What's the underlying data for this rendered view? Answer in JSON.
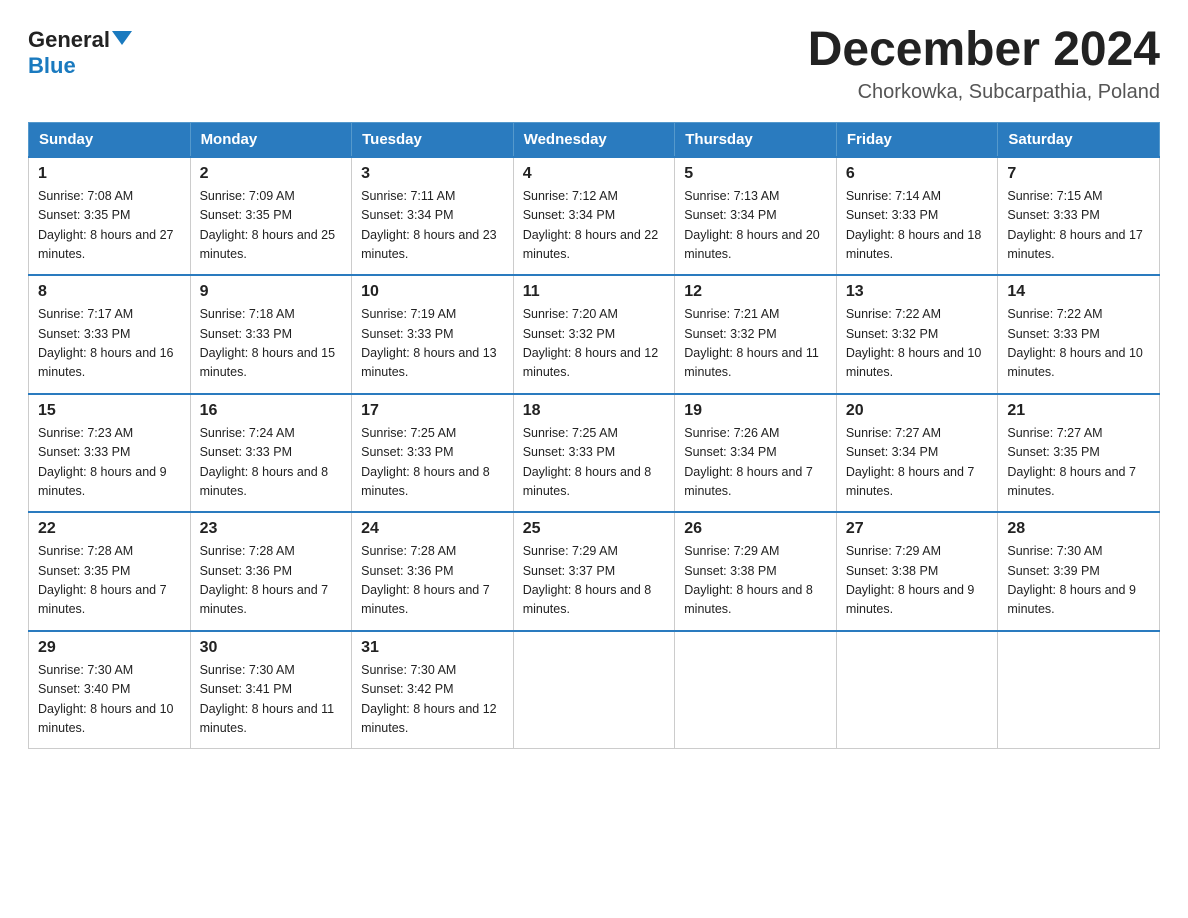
{
  "logo": {
    "line1": "General",
    "arrow": true,
    "line2": "Blue"
  },
  "title": "December 2024",
  "subtitle": "Chorkowka, Subcarpathia, Poland",
  "days_of_week": [
    "Sunday",
    "Monday",
    "Tuesday",
    "Wednesday",
    "Thursday",
    "Friday",
    "Saturday"
  ],
  "weeks": [
    [
      {
        "num": "1",
        "sunrise": "7:08 AM",
        "sunset": "3:35 PM",
        "daylight": "8 hours and 27 minutes."
      },
      {
        "num": "2",
        "sunrise": "7:09 AM",
        "sunset": "3:35 PM",
        "daylight": "8 hours and 25 minutes."
      },
      {
        "num": "3",
        "sunrise": "7:11 AM",
        "sunset": "3:34 PM",
        "daylight": "8 hours and 23 minutes."
      },
      {
        "num": "4",
        "sunrise": "7:12 AM",
        "sunset": "3:34 PM",
        "daylight": "8 hours and 22 minutes."
      },
      {
        "num": "5",
        "sunrise": "7:13 AM",
        "sunset": "3:34 PM",
        "daylight": "8 hours and 20 minutes."
      },
      {
        "num": "6",
        "sunrise": "7:14 AM",
        "sunset": "3:33 PM",
        "daylight": "8 hours and 18 minutes."
      },
      {
        "num": "7",
        "sunrise": "7:15 AM",
        "sunset": "3:33 PM",
        "daylight": "8 hours and 17 minutes."
      }
    ],
    [
      {
        "num": "8",
        "sunrise": "7:17 AM",
        "sunset": "3:33 PM",
        "daylight": "8 hours and 16 minutes."
      },
      {
        "num": "9",
        "sunrise": "7:18 AM",
        "sunset": "3:33 PM",
        "daylight": "8 hours and 15 minutes."
      },
      {
        "num": "10",
        "sunrise": "7:19 AM",
        "sunset": "3:33 PM",
        "daylight": "8 hours and 13 minutes."
      },
      {
        "num": "11",
        "sunrise": "7:20 AM",
        "sunset": "3:32 PM",
        "daylight": "8 hours and 12 minutes."
      },
      {
        "num": "12",
        "sunrise": "7:21 AM",
        "sunset": "3:32 PM",
        "daylight": "8 hours and 11 minutes."
      },
      {
        "num": "13",
        "sunrise": "7:22 AM",
        "sunset": "3:32 PM",
        "daylight": "8 hours and 10 minutes."
      },
      {
        "num": "14",
        "sunrise": "7:22 AM",
        "sunset": "3:33 PM",
        "daylight": "8 hours and 10 minutes."
      }
    ],
    [
      {
        "num": "15",
        "sunrise": "7:23 AM",
        "sunset": "3:33 PM",
        "daylight": "8 hours and 9 minutes."
      },
      {
        "num": "16",
        "sunrise": "7:24 AM",
        "sunset": "3:33 PM",
        "daylight": "8 hours and 8 minutes."
      },
      {
        "num": "17",
        "sunrise": "7:25 AM",
        "sunset": "3:33 PM",
        "daylight": "8 hours and 8 minutes."
      },
      {
        "num": "18",
        "sunrise": "7:25 AM",
        "sunset": "3:33 PM",
        "daylight": "8 hours and 8 minutes."
      },
      {
        "num": "19",
        "sunrise": "7:26 AM",
        "sunset": "3:34 PM",
        "daylight": "8 hours and 7 minutes."
      },
      {
        "num": "20",
        "sunrise": "7:27 AM",
        "sunset": "3:34 PM",
        "daylight": "8 hours and 7 minutes."
      },
      {
        "num": "21",
        "sunrise": "7:27 AM",
        "sunset": "3:35 PM",
        "daylight": "8 hours and 7 minutes."
      }
    ],
    [
      {
        "num": "22",
        "sunrise": "7:28 AM",
        "sunset": "3:35 PM",
        "daylight": "8 hours and 7 minutes."
      },
      {
        "num": "23",
        "sunrise": "7:28 AM",
        "sunset": "3:36 PM",
        "daylight": "8 hours and 7 minutes."
      },
      {
        "num": "24",
        "sunrise": "7:28 AM",
        "sunset": "3:36 PM",
        "daylight": "8 hours and 7 minutes."
      },
      {
        "num": "25",
        "sunrise": "7:29 AM",
        "sunset": "3:37 PM",
        "daylight": "8 hours and 8 minutes."
      },
      {
        "num": "26",
        "sunrise": "7:29 AM",
        "sunset": "3:38 PM",
        "daylight": "8 hours and 8 minutes."
      },
      {
        "num": "27",
        "sunrise": "7:29 AM",
        "sunset": "3:38 PM",
        "daylight": "8 hours and 9 minutes."
      },
      {
        "num": "28",
        "sunrise": "7:30 AM",
        "sunset": "3:39 PM",
        "daylight": "8 hours and 9 minutes."
      }
    ],
    [
      {
        "num": "29",
        "sunrise": "7:30 AM",
        "sunset": "3:40 PM",
        "daylight": "8 hours and 10 minutes."
      },
      {
        "num": "30",
        "sunrise": "7:30 AM",
        "sunset": "3:41 PM",
        "daylight": "8 hours and 11 minutes."
      },
      {
        "num": "31",
        "sunrise": "7:30 AM",
        "sunset": "3:42 PM",
        "daylight": "8 hours and 12 minutes."
      },
      null,
      null,
      null,
      null
    ]
  ]
}
